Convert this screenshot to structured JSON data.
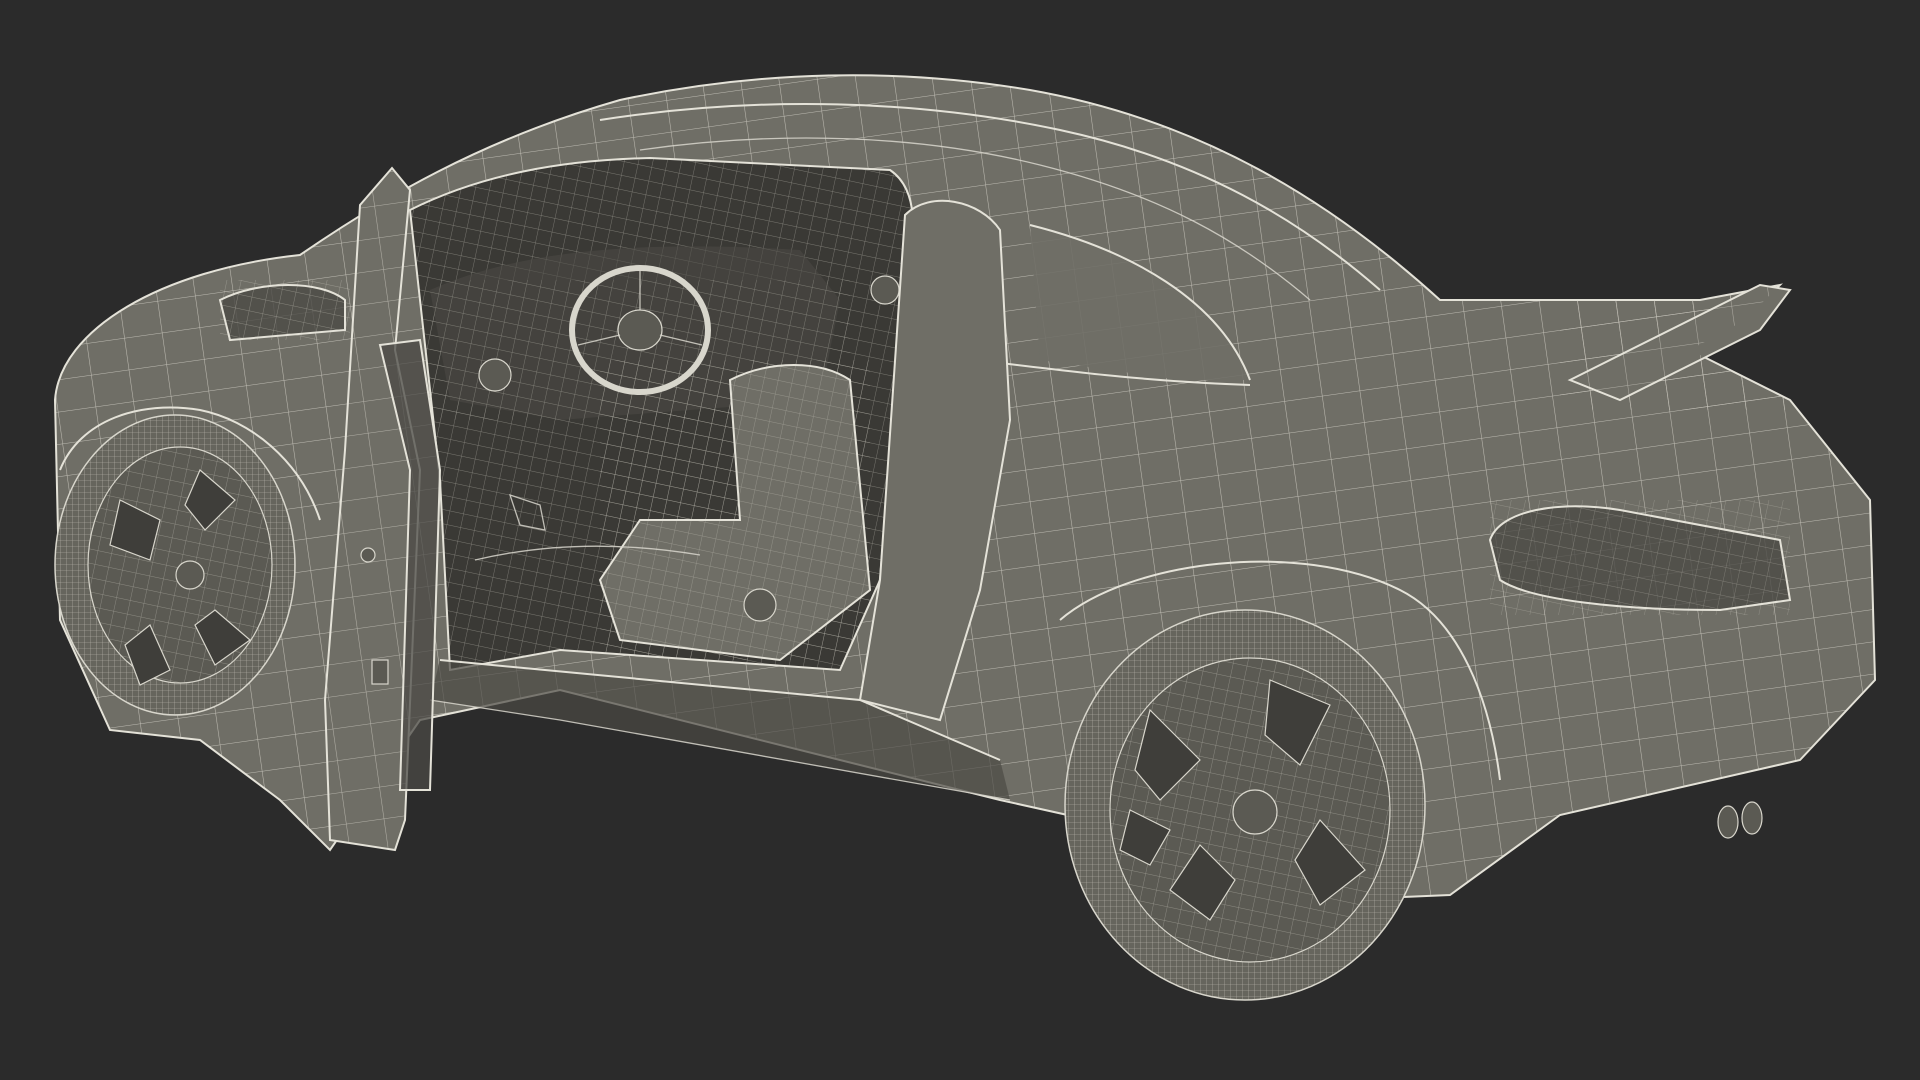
{
  "scene": {
    "background_color": "#2b2b2b",
    "model_color": "#6f6e66",
    "wire_color": "#d8d6cc",
    "subject": "wireframe-car-3d-model"
  }
}
